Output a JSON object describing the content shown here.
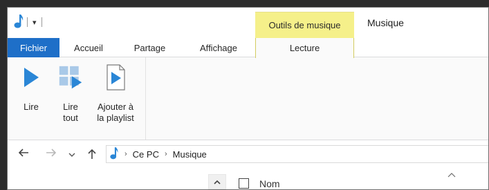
{
  "titlebar": {
    "quick_access_dropdown": "▾",
    "tools_tab": "Outils de musique",
    "window_title": "Musique"
  },
  "tabs": {
    "fichier": "Fichier",
    "accueil": "Accueil",
    "partage": "Partage",
    "affichage": "Affichage",
    "lecture": "Lecture"
  },
  "ribbon": {
    "lire": "Lire",
    "lire_tout_1": "Lire",
    "lire_tout_2": "tout",
    "ajouter_1": "Ajouter à",
    "ajouter_2": "la playlist"
  },
  "address": {
    "crumbs": [
      "Ce PC",
      "Musique"
    ]
  },
  "columns": {
    "name": "Nom"
  },
  "colors": {
    "file_tab": "#1e6fc8",
    "tools_tab": "#f5f08a",
    "icon_blue": "#2a86d6"
  }
}
